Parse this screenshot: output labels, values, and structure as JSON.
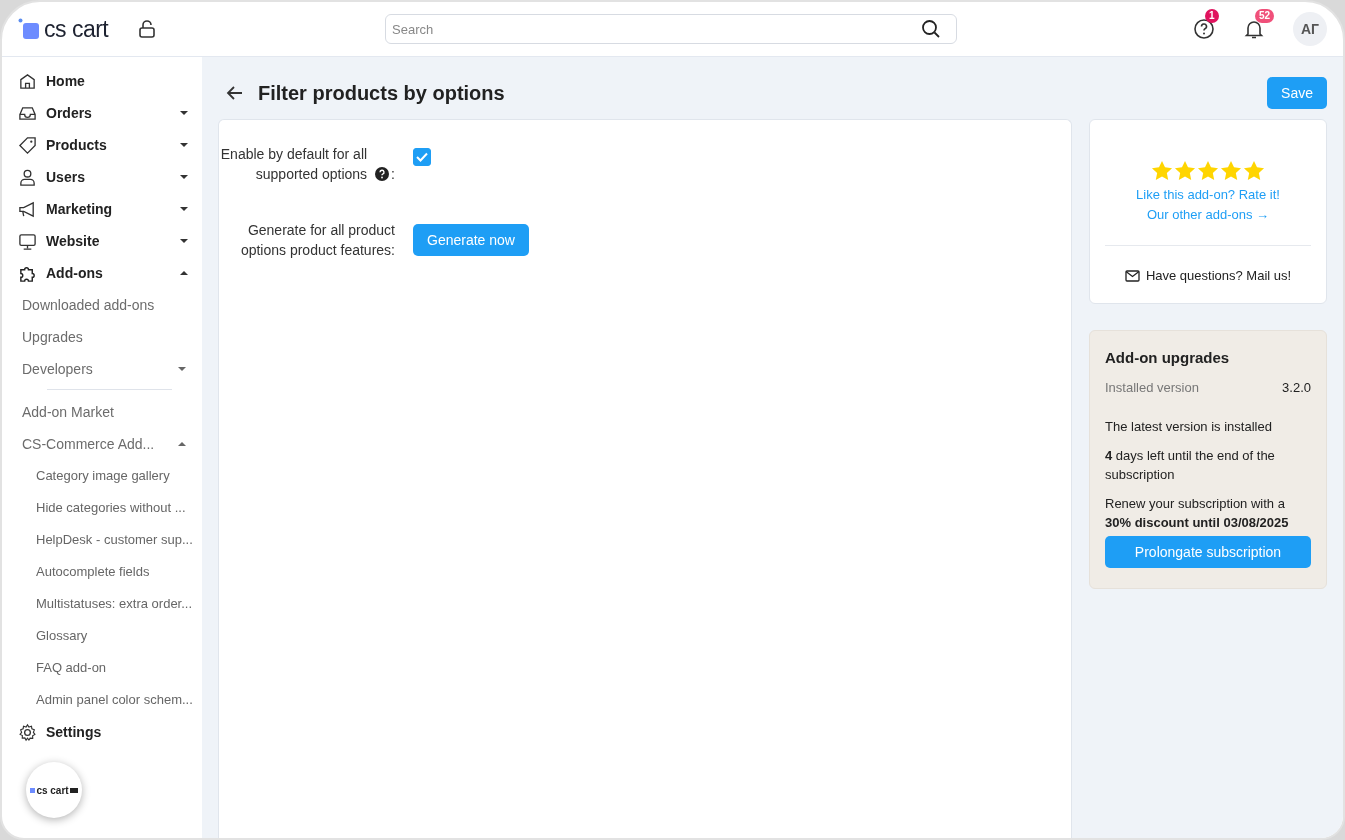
{
  "header": {
    "logo": "cs cart",
    "search": {
      "placeholder": "Search"
    },
    "help_badge": "1",
    "notifications_badge": "52",
    "avatar": "АГ"
  },
  "sidebar": {
    "items": [
      {
        "label": "Home"
      },
      {
        "label": "Orders",
        "expanded": false
      },
      {
        "label": "Products",
        "expanded": false
      },
      {
        "label": "Users",
        "expanded": false
      },
      {
        "label": "Marketing",
        "expanded": false
      },
      {
        "label": "Website",
        "expanded": false
      },
      {
        "label": "Add-ons",
        "expanded": true,
        "children": [
          {
            "label": "Downloaded add-ons"
          },
          {
            "label": "Upgrades"
          },
          {
            "label": "Developers",
            "expanded": false
          },
          {
            "label": "Add-on Market",
            "divider_before": true
          },
          {
            "label": "CS-Commerce Add...",
            "expanded": true,
            "children": [
              {
                "label": "Category image gallery"
              },
              {
                "label": "Hide categories without ..."
              },
              {
                "label": "HelpDesk - customer sup..."
              },
              {
                "label": "Autocomplete fields"
              },
              {
                "label": "Multistatuses: extra order..."
              },
              {
                "label": "Glossary"
              },
              {
                "label": "FAQ add-on"
              },
              {
                "label": "Admin panel color schem..."
              }
            ]
          }
        ]
      },
      {
        "label": "Settings"
      }
    ],
    "mini_logo": "cs cart"
  },
  "page": {
    "title": "Filter products by options",
    "save": "Save"
  },
  "settings": [
    {
      "kind": "checkbox",
      "label": "Enable by default for all supported options",
      "suffix": ":",
      "checked": true
    },
    {
      "kind": "button",
      "label": "Generate for all product options product features:",
      "button": "Generate now"
    }
  ],
  "rating_card": {
    "stars": 5,
    "rate_link": "Like this add-on? Rate it!",
    "other_link": "Our other add-ons →",
    "mail": "Have questions? Mail us!"
  },
  "upgrades_card": {
    "title": "Add-on upgrades",
    "installed_label": "Installed version",
    "installed_value": "3.2.0",
    "status": "The latest version is installed",
    "days": "**4** days left until the end of the subscription",
    "renew": "Renew your subscription with a **30% discount until 03/08/2025**",
    "button": "Prolongate subscription"
  }
}
